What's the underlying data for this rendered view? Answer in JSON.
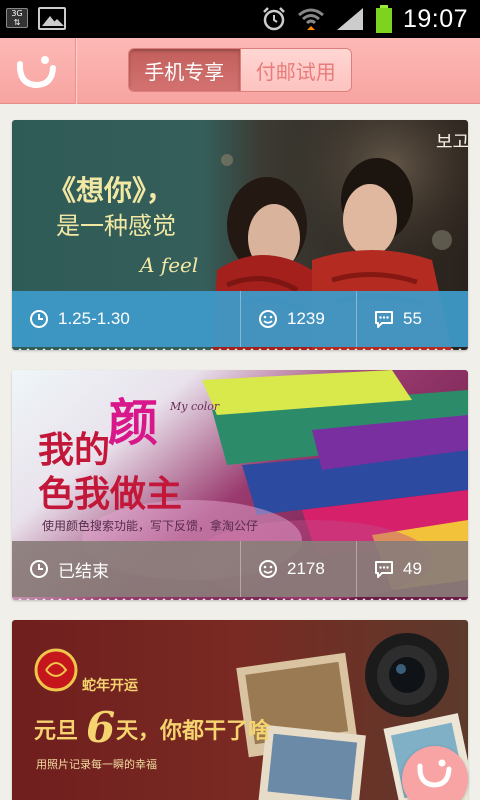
{
  "status_bar": {
    "network_badge": "3G",
    "time": "19:07",
    "icons": [
      "image-notification-icon",
      "alarm-icon",
      "wifi-icon",
      "cell-signal-icon",
      "battery-icon"
    ]
  },
  "header": {
    "logo_icon": "smile-logo-icon",
    "tabs": [
      {
        "label": "手机专享",
        "active": true
      },
      {
        "label": "付邮试用",
        "active": false
      }
    ]
  },
  "feed": {
    "cards": [
      {
        "banner": {
          "title": "《想你》，",
          "subtitle": "是一种感觉",
          "tagline": "A feel",
          "corner_text": "보고"
        },
        "date": "1.25-1.30",
        "comments": "1239",
        "messages": "55",
        "bar_color": "#3e9ac9"
      },
      {
        "banner": {
          "line1": "我的",
          "accent": "颜",
          "script": "My color",
          "line2": "色我做主",
          "caption": "使用颜色搜索功能，写下反馈，拿淘公仔"
        },
        "date": "已结束",
        "comments": "2178",
        "messages": "49",
        "bar_color": "#8a7d7a"
      },
      {
        "banner": {
          "badge": "蛇年开运",
          "headline_a": "元旦",
          "headline_num": "6",
          "headline_b": "天，你都干了啥",
          "caption": "用照片记录每一瞬的幸福"
        }
      }
    ]
  },
  "colors": {
    "header_pink": "#f9acaa",
    "segment_active": "#c86462",
    "segment_inactive_text": "#e77d7b",
    "page_bg": "#f1efe9"
  }
}
